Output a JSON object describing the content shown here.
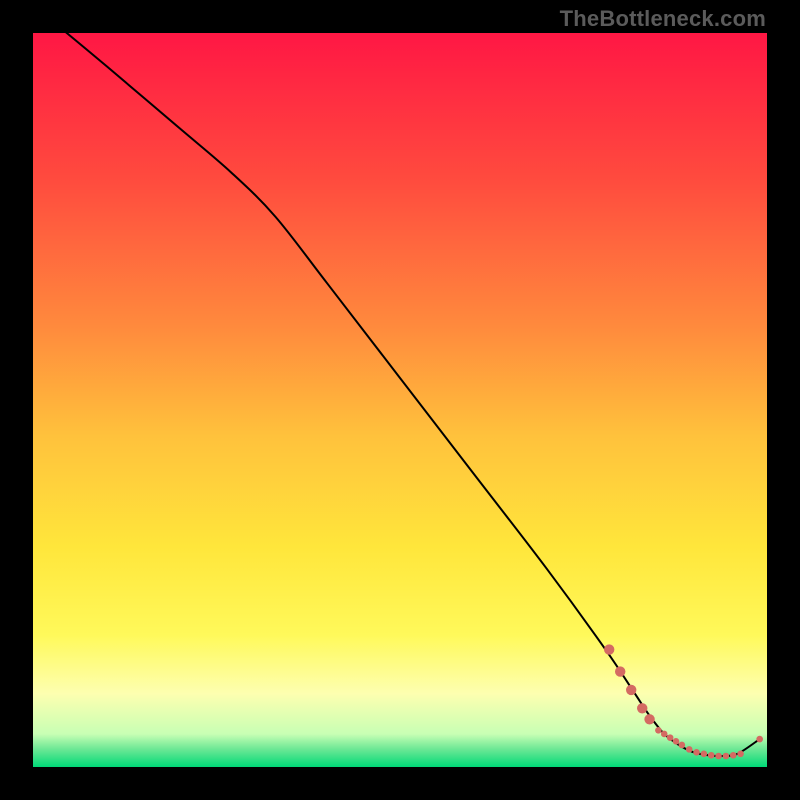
{
  "watermark": "TheBottleneck.com",
  "chart_data": {
    "type": "line",
    "title": "",
    "xlabel": "",
    "ylabel": "",
    "xlim": [
      0,
      100
    ],
    "ylim": [
      0,
      100
    ],
    "grid": false,
    "legend": false,
    "axes_visible": false,
    "background": {
      "style": "vertical-gradient",
      "stops": [
        {
          "pos": 0.0,
          "color": "#ff1744"
        },
        {
          "pos": 0.2,
          "color": "#ff4b3e"
        },
        {
          "pos": 0.4,
          "color": "#ff8a3d"
        },
        {
          "pos": 0.55,
          "color": "#ffc23c"
        },
        {
          "pos": 0.7,
          "color": "#ffe63b"
        },
        {
          "pos": 0.82,
          "color": "#fff95a"
        },
        {
          "pos": 0.9,
          "color": "#fdffb0"
        },
        {
          "pos": 0.955,
          "color": "#c8ffb4"
        },
        {
          "pos": 0.975,
          "color": "#6fe896"
        },
        {
          "pos": 1.0,
          "color": "#00d977"
        }
      ]
    },
    "series": [
      {
        "name": "bottleneck-curve",
        "color": "#000000",
        "stroke_width": 2,
        "fill": false,
        "x": [
          4,
          10,
          20,
          27,
          33,
          40,
          50,
          60,
          70,
          78,
          82,
          84,
          86,
          88,
          90,
          92,
          94,
          96,
          99
        ],
        "y": [
          100.5,
          95.5,
          87,
          81,
          75,
          66,
          53,
          40,
          27,
          16,
          10,
          7,
          4.5,
          3,
          2,
          1.6,
          1.5,
          1.8,
          3.8
        ]
      }
    ],
    "markers": {
      "name": "bottleneck-band",
      "color": "#d46a62",
      "shape": "circle",
      "radius_main": 5.2,
      "radius_small": 3.3,
      "points": [
        {
          "x": 78.5,
          "y": 16,
          "r": "main"
        },
        {
          "x": 80.0,
          "y": 13,
          "r": "main"
        },
        {
          "x": 81.5,
          "y": 10.5,
          "r": "main"
        },
        {
          "x": 83.0,
          "y": 8,
          "r": "main"
        },
        {
          "x": 84.0,
          "y": 6.5,
          "r": "main"
        },
        {
          "x": 85.2,
          "y": 5.0,
          "r": "small"
        },
        {
          "x": 86.0,
          "y": 4.5,
          "r": "small"
        },
        {
          "x": 86.8,
          "y": 4.0,
          "r": "small"
        },
        {
          "x": 87.6,
          "y": 3.5,
          "r": "small"
        },
        {
          "x": 88.4,
          "y": 3.0,
          "r": "small"
        },
        {
          "x": 89.4,
          "y": 2.4,
          "r": "small"
        },
        {
          "x": 90.4,
          "y": 2.0,
          "r": "small"
        },
        {
          "x": 91.4,
          "y": 1.8,
          "r": "small"
        },
        {
          "x": 92.4,
          "y": 1.6,
          "r": "small"
        },
        {
          "x": 93.4,
          "y": 1.5,
          "r": "small"
        },
        {
          "x": 94.4,
          "y": 1.5,
          "r": "small"
        },
        {
          "x": 95.4,
          "y": 1.6,
          "r": "small"
        },
        {
          "x": 96.4,
          "y": 1.8,
          "r": "small"
        },
        {
          "x": 99.0,
          "y": 3.8,
          "r": "small"
        }
      ]
    }
  }
}
